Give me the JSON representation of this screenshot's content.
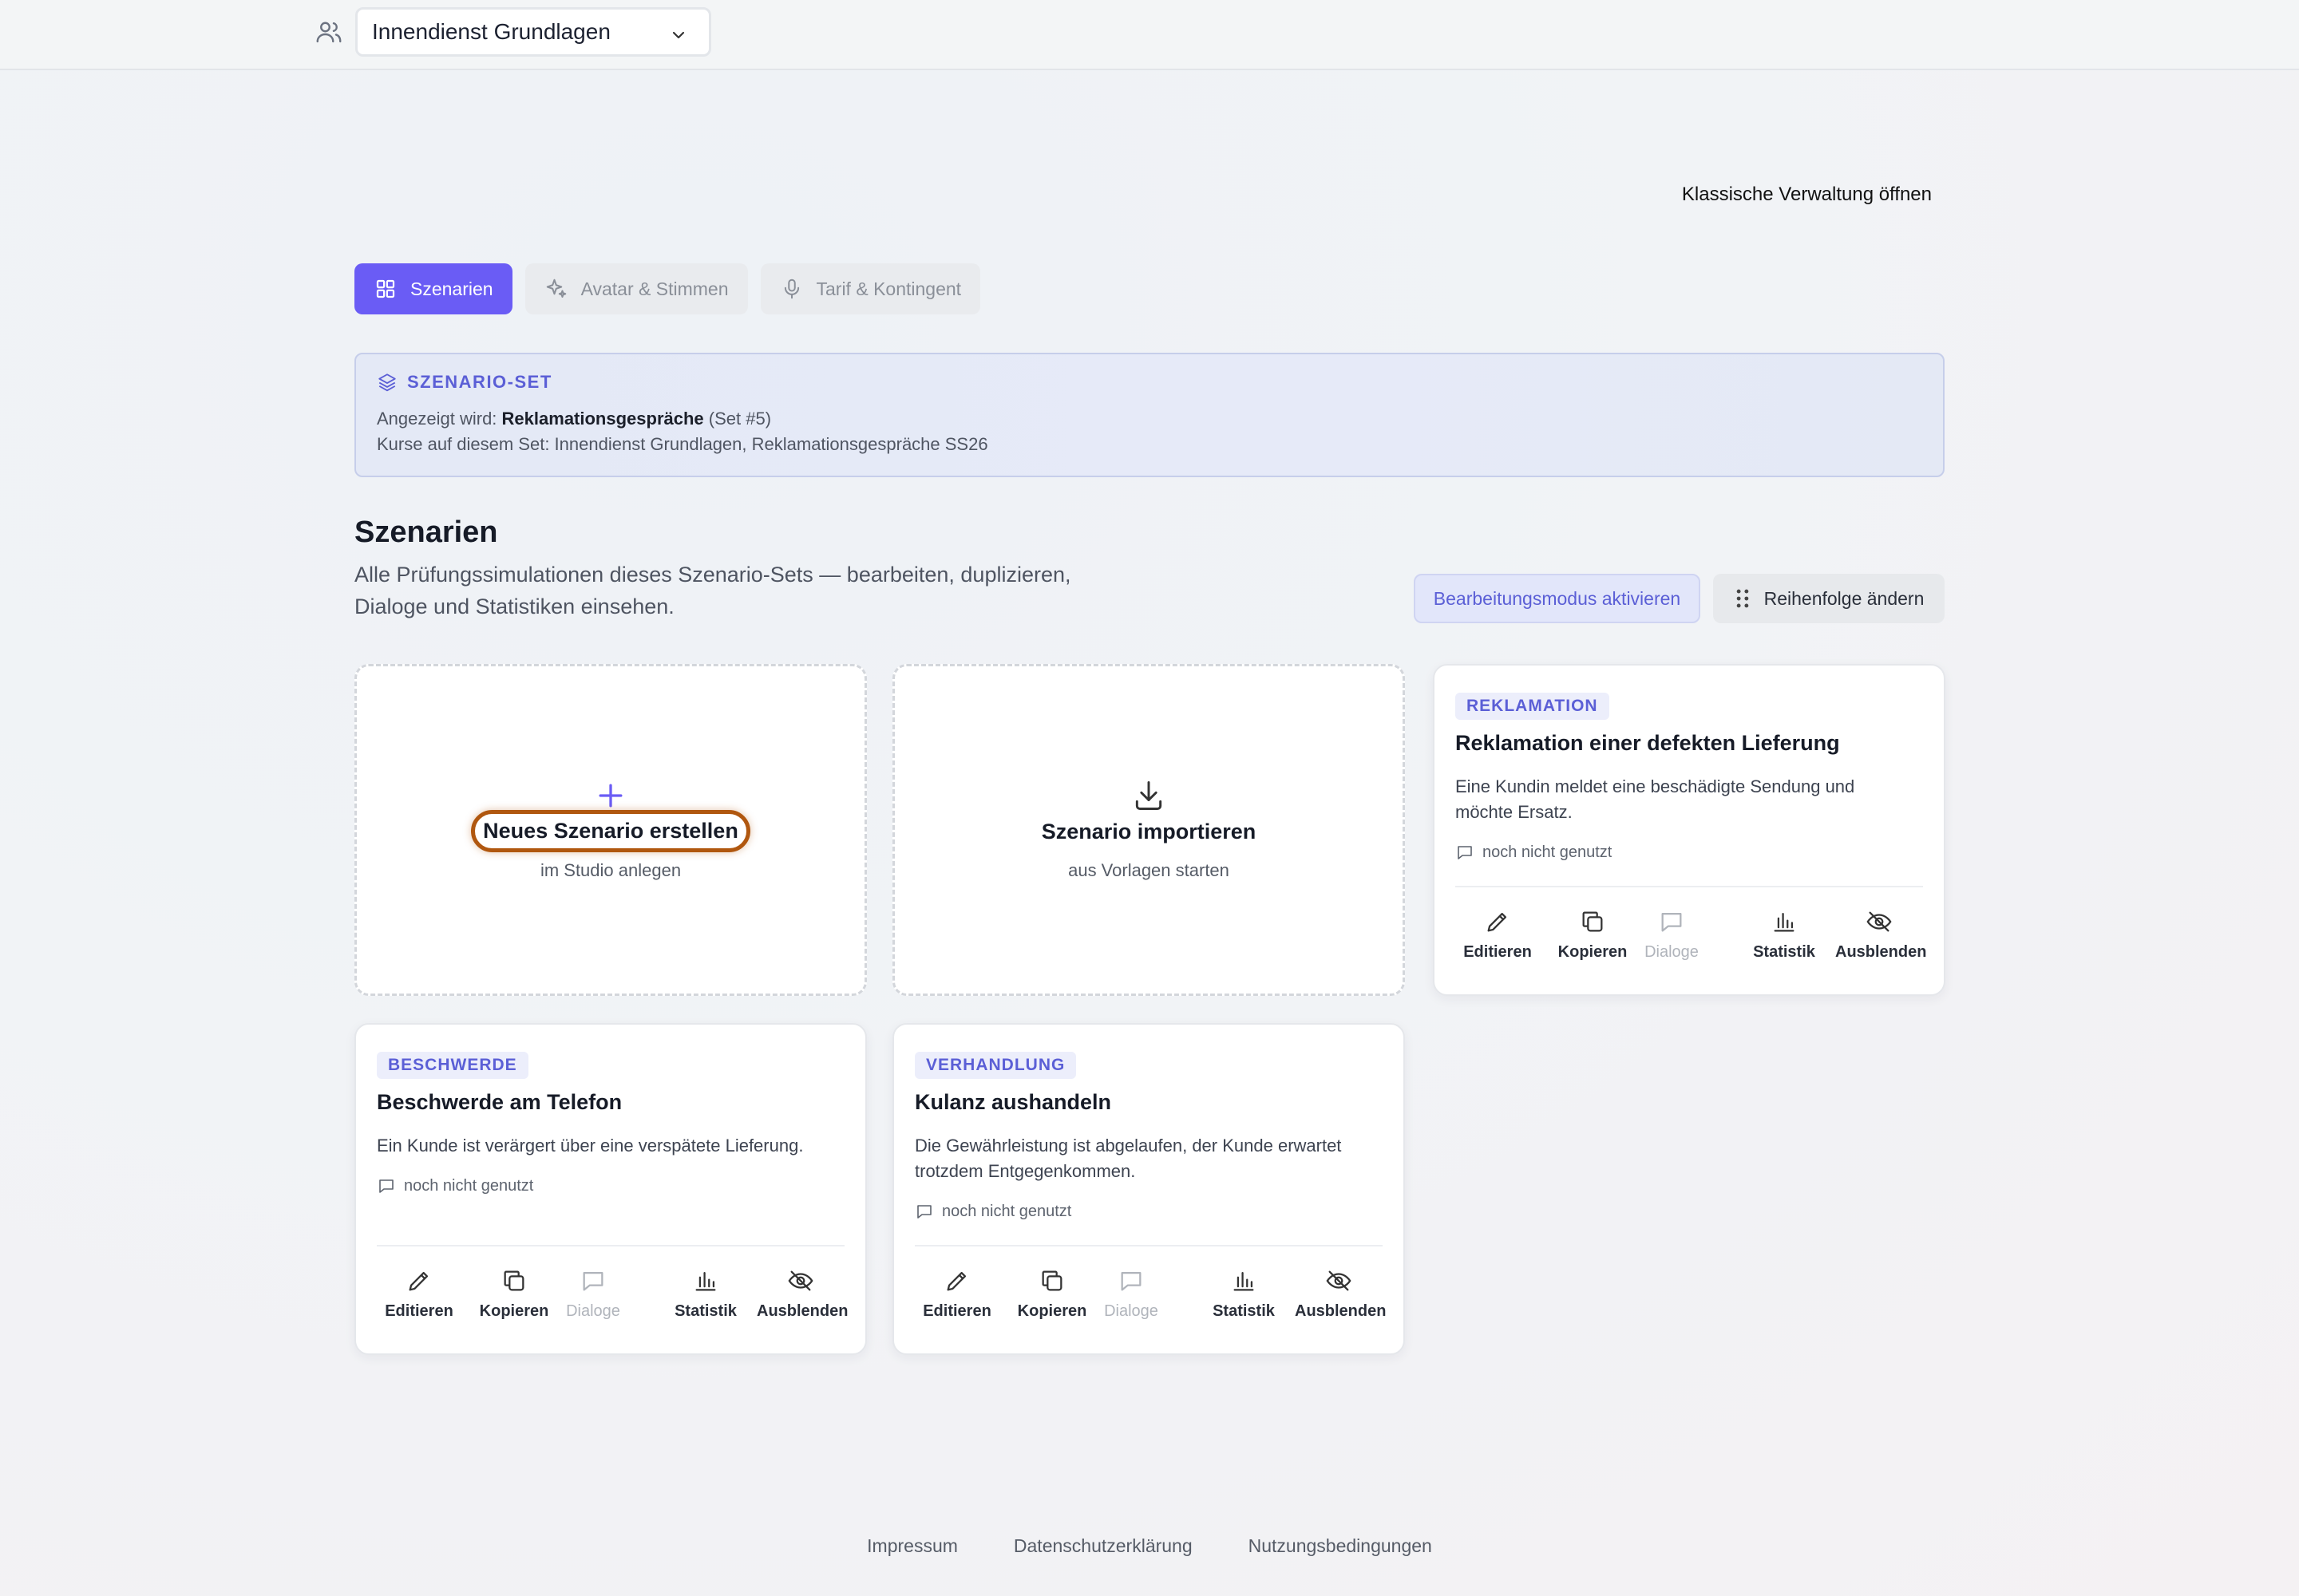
{
  "topbar": {
    "course_selected": "Innendienst Grundlagen"
  },
  "header": {
    "classic_link": "Klassische Verwaltung öffnen"
  },
  "tabs": [
    {
      "label": "Szenarien"
    },
    {
      "label": "Avatar & Stimmen"
    },
    {
      "label": "Tarif & Kontingent"
    }
  ],
  "scenario_set": {
    "heading": "SZENARIO-SET",
    "shown_prefix": "Angezeigt wird:",
    "shown_name": "Reklamationsgespräche",
    "shown_suffix": "(Set #5)",
    "courses": "Kurse auf diesem Set: Innendienst Grundlagen, Reklamationsgespräche SS26"
  },
  "section": {
    "title": "Szenarien",
    "description": "Alle Prüfungssimulationen dieses Szenario-Sets — bearbeiten, duplizieren, Dialoge und Statistiken einsehen.",
    "edit_mode_button": "Bearbeitungsmodus aktivieren",
    "reorder_button": "Reihenfolge ändern"
  },
  "create_card": {
    "title": "Neues Szenario erstellen",
    "sub": "im Studio anlegen"
  },
  "import_card": {
    "title": "Szenario importieren",
    "sub": "aus Vorlagen starten"
  },
  "action_labels": {
    "edit": "Editieren",
    "copy": "Kopieren",
    "dialogs": "Dialoge",
    "stats": "Statistik",
    "hide": "Ausblenden"
  },
  "scenarios": [
    {
      "tag": "REKLAMATION",
      "title": "Reklamation einer defekten Lieferung",
      "description": "Eine Kundin meldet eine beschädigte Sendung und möchte Ersatz.",
      "usage": "noch nicht genutzt"
    },
    {
      "tag": "BESCHWERDE",
      "title": "Beschwerde am Telefon",
      "description": "Ein Kunde ist verärgert über eine verspätete Lieferung.",
      "usage": "noch nicht genutzt"
    },
    {
      "tag": "VERHANDLUNG",
      "title": "Kulanz aushandeln",
      "description": "Die Gewährleistung ist abgelaufen, der Kunde erwartet trotzdem Entgegenkommen.",
      "usage": "noch nicht genutzt"
    }
  ],
  "footer": {
    "impressum": "Impressum",
    "privacy": "Datenschutzerklärung",
    "terms": "Nutzungsbedingungen"
  },
  "colors": {
    "accent": "#6a5cf5",
    "tag_text": "#5b5fd6",
    "highlight_ring": "#b0570f"
  }
}
